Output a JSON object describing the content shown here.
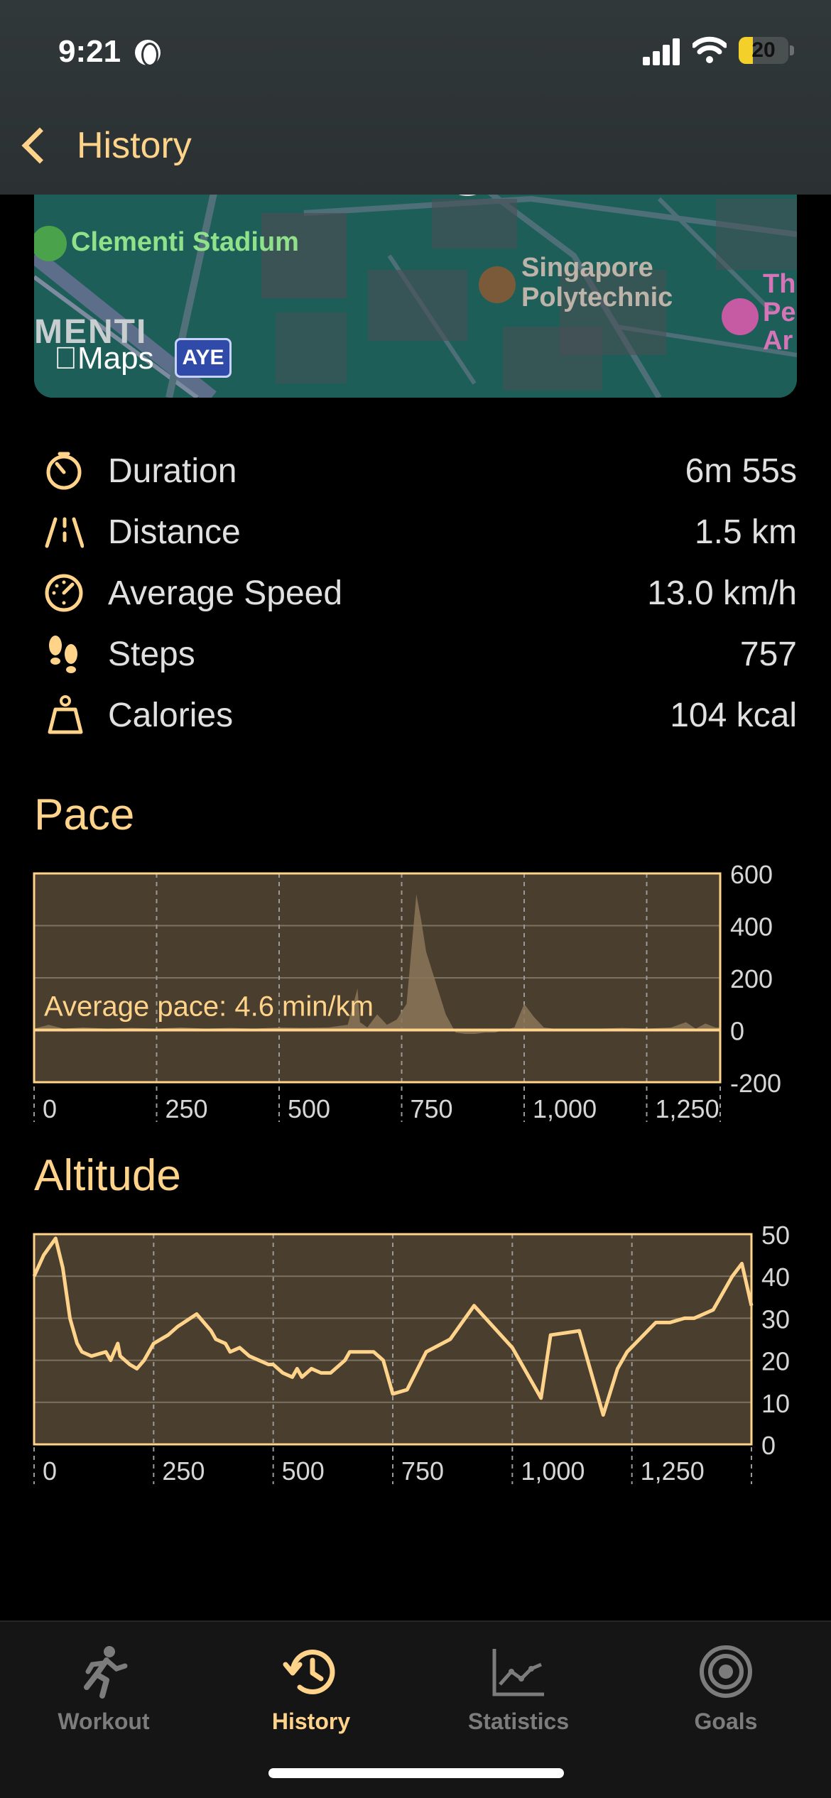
{
  "status_bar": {
    "time": "9:21",
    "battery": "20"
  },
  "nav": {
    "back_label": "History"
  },
  "map": {
    "labels": {
      "stadium": "Clementi Stadium",
      "poly_line1": "Singapore",
      "poly_line2": "Polytechnic",
      "district": "MENTI",
      "the_line1": "Th",
      "the_line2": "Pe",
      "the_line3": "Ar",
      "maps": "Maps",
      "road": "AYE"
    }
  },
  "metrics": [
    {
      "icon": "stopwatch-icon",
      "label": "Duration",
      "value": "6m 55s"
    },
    {
      "icon": "road-icon",
      "label": "Distance",
      "value": "1.5 km"
    },
    {
      "icon": "speedometer-icon",
      "label": "Average Speed",
      "value": "13.0 km/h"
    },
    {
      "icon": "footprints-icon",
      "label": "Steps",
      "value": "757"
    },
    {
      "icon": "weight-icon",
      "label": "Calories",
      "value": "104 kcal"
    }
  ],
  "pace": {
    "title": "Pace",
    "average_label": "Average pace: 4.6 min/km"
  },
  "altitude": {
    "title": "Altitude"
  },
  "colors": {
    "accent": "#ffd38a",
    "chart_fill": "#4a3e2f",
    "active_tab": "#ffd38a",
    "inactive_tab": "#7c7c7c"
  },
  "chart_data": [
    {
      "type": "area",
      "title": "Pace",
      "xlim": [
        0,
        1400
      ],
      "ylim": [
        -200,
        600
      ],
      "x_ticks": [
        0,
        250,
        500,
        750,
        1000,
        1250
      ],
      "x_tick_labels": [
        "0",
        "250",
        "500",
        "750",
        "1,000",
        "1,250"
      ],
      "y_ticks": [
        600,
        400,
        200,
        0,
        -200
      ],
      "y_tick_labels": [
        "600",
        "400",
        "200",
        "0",
        "-200"
      ],
      "average_line": 0,
      "annotation": "Average pace: 4.6 min/km",
      "x": [
        0,
        30,
        60,
        100,
        150,
        200,
        250,
        300,
        350,
        400,
        450,
        500,
        550,
        600,
        640,
        660,
        665,
        680,
        700,
        720,
        740,
        760,
        780,
        790,
        800,
        820,
        840,
        860,
        880,
        900,
        920,
        940,
        960,
        980,
        1000,
        1020,
        1040,
        1060,
        1080,
        1100,
        1150,
        1200,
        1250,
        1300,
        1330,
        1350,
        1370,
        1390,
        1400
      ],
      "y": [
        5,
        20,
        5,
        10,
        5,
        8,
        5,
        10,
        5,
        8,
        5,
        10,
        8,
        10,
        20,
        160,
        30,
        10,
        60,
        20,
        40,
        100,
        520,
        420,
        300,
        180,
        60,
        -10,
        -15,
        -15,
        -10,
        -10,
        0,
        10,
        100,
        50,
        10,
        5,
        5,
        5,
        5,
        8,
        5,
        10,
        30,
        5,
        25,
        10,
        10
      ]
    },
    {
      "type": "line",
      "title": "Altitude",
      "xlim": [
        0,
        1500
      ],
      "ylim": [
        0,
        50
      ],
      "x_ticks": [
        0,
        250,
        500,
        750,
        1000,
        1250
      ],
      "x_tick_labels": [
        "0",
        "250",
        "500",
        "750",
        "1,000",
        "1,250"
      ],
      "y_ticks": [
        50,
        40,
        30,
        20,
        10,
        0
      ],
      "y_tick_labels": [
        "50",
        "40",
        "30",
        "20",
        10,
        "0"
      ],
      "x": [
        0,
        20,
        45,
        60,
        75,
        90,
        100,
        120,
        150,
        160,
        175,
        180,
        200,
        215,
        230,
        240,
        250,
        280,
        300,
        340,
        370,
        380,
        400,
        410,
        430,
        450,
        470,
        490,
        500,
        520,
        540,
        550,
        560,
        570,
        580,
        600,
        620,
        650,
        660,
        690,
        710,
        720,
        730,
        750,
        780,
        820,
        870,
        920,
        1000,
        1060,
        1080,
        1140,
        1190,
        1220,
        1240,
        1300,
        1330,
        1360,
        1380,
        1400,
        1420,
        1440,
        1460,
        1480,
        1490,
        1500
      ],
      "y": [
        40,
        45,
        49,
        42,
        30,
        24,
        22,
        21,
        22,
        20,
        24,
        21,
        19,
        18,
        20,
        22,
        24,
        26,
        28,
        31,
        27,
        25,
        24,
        22,
        23,
        21,
        20,
        19,
        19,
        17,
        16,
        18,
        16,
        17,
        18,
        17,
        17,
        20,
        22,
        22,
        22,
        21,
        20,
        12,
        13,
        22,
        25,
        33,
        23,
        11,
        26,
        27,
        7,
        18,
        22,
        29,
        29,
        30,
        30,
        31,
        32,
        36,
        40,
        43,
        38,
        33
      ]
    }
  ],
  "tabs": [
    {
      "label": "Workout",
      "icon": "runner-icon",
      "active": false
    },
    {
      "label": "History",
      "icon": "history-clock-icon",
      "active": true
    },
    {
      "label": "Statistics",
      "icon": "line-chart-icon",
      "active": false
    },
    {
      "label": "Goals",
      "icon": "target-icon",
      "active": false
    }
  ]
}
